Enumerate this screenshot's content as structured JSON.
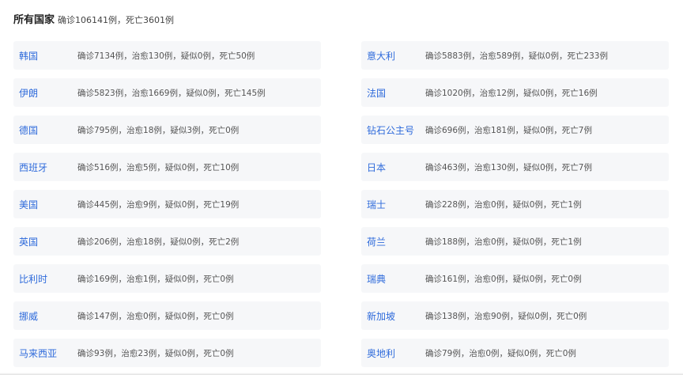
{
  "header": {
    "title": "所有国家",
    "summary": "确诊106141例，死亡3601例"
  },
  "countries": [
    {
      "name": "韩国",
      "stats": "确诊7134例，治愈130例，疑似0例，死亡50例"
    },
    {
      "name": "意大利",
      "stats": "确诊5883例，治愈589例，疑似0例，死亡233例"
    },
    {
      "name": "伊朗",
      "stats": "确诊5823例，治愈1669例，疑似0例，死亡145例"
    },
    {
      "name": "法国",
      "stats": "确诊1020例，治愈12例，疑似0例，死亡16例"
    },
    {
      "name": "德国",
      "stats": "确诊795例，治愈18例，疑似3例，死亡0例"
    },
    {
      "name": "钻石公主号",
      "stats": "确诊696例，治愈181例，疑似0例，死亡7例"
    },
    {
      "name": "西班牙",
      "stats": "确诊516例，治愈5例，疑似0例，死亡10例"
    },
    {
      "name": "日本",
      "stats": "确诊463例，治愈130例，疑似0例，死亡7例"
    },
    {
      "name": "美国",
      "stats": "确诊445例，治愈9例，疑似0例，死亡19例"
    },
    {
      "name": "瑞士",
      "stats": "确诊228例，治愈0例，疑似0例，死亡1例"
    },
    {
      "name": "英国",
      "stats": "确诊206例，治愈18例，疑似0例，死亡2例"
    },
    {
      "name": "荷兰",
      "stats": "确诊188例，治愈0例，疑似0例，死亡1例"
    },
    {
      "name": "比利时",
      "stats": "确诊169例，治愈1例，疑似0例，死亡0例"
    },
    {
      "name": "瑞典",
      "stats": "确诊161例，治愈0例，疑似0例，死亡0例"
    },
    {
      "name": "挪威",
      "stats": "确诊147例，治愈0例，疑似0例，死亡0例"
    },
    {
      "name": "新加坡",
      "stats": "确诊138例，治愈90例，疑似0例，死亡0例"
    },
    {
      "name": "马来西亚",
      "stats": "确诊93例，治愈23例，疑似0例，死亡0例"
    },
    {
      "name": "奥地利",
      "stats": "确诊79例，治愈0例，疑似0例，死亡0例"
    }
  ]
}
